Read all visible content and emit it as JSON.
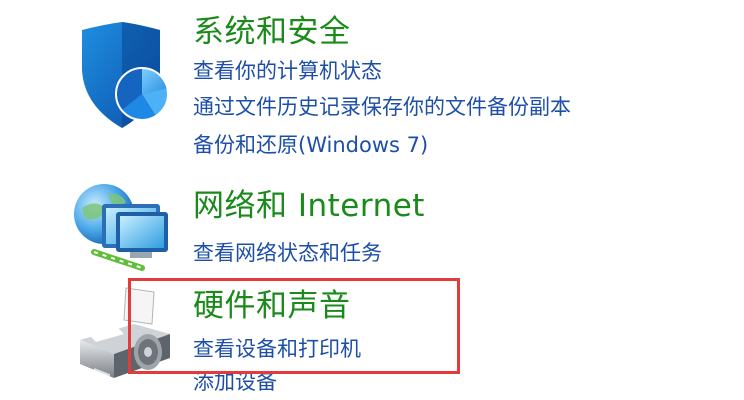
{
  "categories": [
    {
      "title": "系统和安全",
      "icon": "shield-icon",
      "links": [
        "查看你的计算机状态",
        "通过文件历史记录保存你的文件备份副本",
        "备份和还原(Windows 7)"
      ]
    },
    {
      "title": "网络和 Internet",
      "icon": "network-globe-icon",
      "links": [
        "查看网络状态和任务"
      ]
    },
    {
      "title": "硬件和声音",
      "icon": "printer-icon",
      "links": [
        "查看设备和打印机",
        "添加设备"
      ]
    }
  ],
  "colors": {
    "title": "#1a8a1a",
    "link": "#1e4fa8",
    "highlight": "#e23b3b"
  }
}
